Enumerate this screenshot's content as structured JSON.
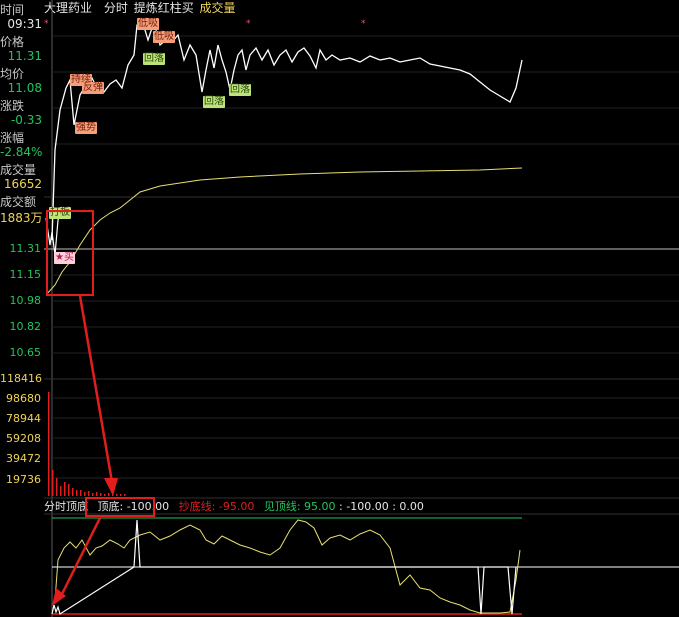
{
  "header": {
    "time_label": "时间",
    "stock_name": "大理药业",
    "mode": "分时",
    "indicator": "提炼红柱买",
    "volume_label": "成交量"
  },
  "sidebar": {
    "time_value": "09:31",
    "price_label": "价格",
    "price_value": "11.31",
    "avg_label": "均价",
    "avg_value": "11.08",
    "change_label": "涨跌",
    "change_value": "-0.33",
    "pct_label": "涨幅",
    "pct_value": "-2.84%",
    "vol_label": "成交量",
    "vol_value": "16652",
    "amount_label": "成交额",
    "amount_value": "1883万"
  },
  "price_axis": [
    "11.31",
    "11.15",
    "10.98",
    "10.82",
    "10.65"
  ],
  "volume_axis": [
    "118416",
    "98680",
    "78944",
    "59208",
    "39472",
    "19736"
  ],
  "indicator_bar": {
    "name": "分时顶底",
    "top_bottom_label": "顶底: -100.00",
    "bottom_line_label": "抄底线: -95.00",
    "top_line_label": "见顶线: 95.00",
    "values": ": -100.00 : 0.00"
  },
  "tags": {
    "buy1": "持续",
    "buy2": "反弹",
    "buy3": "低吸",
    "buy4": "强势",
    "sell1": "低吸",
    "sell2": "回落",
    "sell3": "回落",
    "sell4": "回落",
    "sell5": "回落",
    "open_buy": "打板",
    "hl": "★买"
  },
  "colors": {
    "price_line": "#ffffff",
    "avg_line": "#e8e070",
    "red_line": "#e11d1d",
    "green_line": "#22c55e",
    "volume_bar": "#e11d1d"
  }
}
